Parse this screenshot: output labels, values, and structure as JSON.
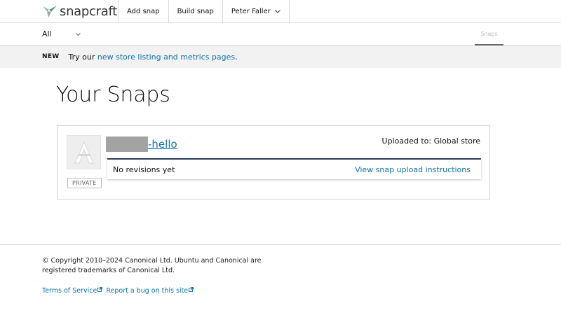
{
  "brand": {
    "name": "snapcraft",
    "accent": "#82bea0"
  },
  "nav": {
    "items": [
      {
        "label": "Add snap"
      },
      {
        "label": "Build snap"
      },
      {
        "label": "Peter Faller"
      }
    ]
  },
  "subnav": {
    "filter_value": "All",
    "tab_label": "Snaps"
  },
  "notice": {
    "badge": "NEW",
    "prefix": "Try our ",
    "link": "new store listing and metrics pages",
    "suffix": "."
  },
  "page": {
    "title": "Your Snaps"
  },
  "snap": {
    "name_suffix": "-hello",
    "status_badge": "PRIVATE",
    "uploaded_to": "Uploaded to: Global store",
    "revisions_text": "No revisions yet",
    "upload_instructions_link": "View snap upload instructions"
  },
  "footer": {
    "copyright": "© Copyright 2010–2024 Canonical Ltd. Ubuntu and Canonical are registered trademarks of Canonical Ltd.",
    "links": [
      {
        "label": "Terms of Service"
      },
      {
        "label": "Report a bug on this site"
      }
    ]
  },
  "colors": {
    "link": "#0e73a8",
    "revision_border": "#2c3e5c",
    "notice_bg": "#f2f2f2"
  },
  "icons": {
    "logo": "hummingbird-logo-icon",
    "dropdown": "chevron-down-icon",
    "snap_placeholder": "snap-placeholder-icon",
    "external": "external-link-icon"
  }
}
